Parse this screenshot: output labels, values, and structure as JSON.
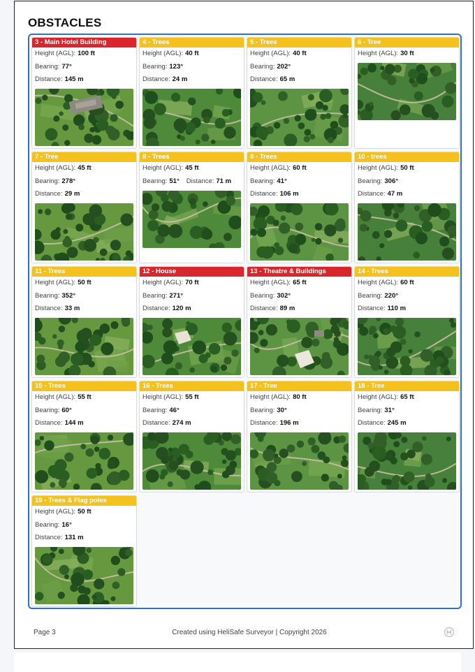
{
  "title": "OBSTACLES",
  "labels": {
    "height": "Height (AGL):",
    "bearing": "Bearing:",
    "distance": "Distance:"
  },
  "colors": {
    "caution": "#f5c11c",
    "hazard": "#d9262c",
    "panel_border": "#2e72c8"
  },
  "obstacles": [
    {
      "header": "3 - Main Hotel Building",
      "level": "red",
      "height": "100 ft",
      "bearing": "77°",
      "distance": "145 m",
      "image": "aerial-photo-hotel"
    },
    {
      "header": "4 - Trees",
      "level": "yellow",
      "height": "40 ft",
      "bearing": "123°",
      "distance": "24 m",
      "image": "aerial-photo-trees"
    },
    {
      "header": "5 - Trees",
      "level": "yellow",
      "height": "40 ft",
      "bearing": "202°",
      "distance": "65 m",
      "image": "aerial-photo-trees"
    },
    {
      "header": "6 - Tree",
      "level": "yellow",
      "height": "30 ft",
      "bearing": "",
      "distance": "",
      "image": "aerial-photo-tree"
    },
    {
      "header": "7 - Tree",
      "level": "yellow",
      "height": "45 ft",
      "bearing": "278°",
      "distance": "29 m",
      "image": "aerial-photo-tree"
    },
    {
      "header": "8 - Trees",
      "level": "yellow",
      "height": "45 ft",
      "bearing": "51°",
      "distance": "71 m",
      "inline": true,
      "image": "aerial-photo-trees"
    },
    {
      "header": "9 - Trees",
      "level": "yellow",
      "height": "60 ft",
      "bearing": "41°",
      "distance": "106 m",
      "image": "aerial-photo-trees"
    },
    {
      "header": "10 - trees",
      "level": "yellow",
      "height": "50 ft",
      "bearing": "306°",
      "distance": "47 m",
      "image": "aerial-photo-trees"
    },
    {
      "header": "11 - Trees",
      "level": "yellow",
      "height": "50 ft",
      "bearing": "352°",
      "distance": "33 m",
      "image": "aerial-photo-trees"
    },
    {
      "header": "12 - House",
      "level": "red",
      "height": "70 ft",
      "bearing": "271°",
      "distance": "120 m",
      "image": "aerial-photo-house"
    },
    {
      "header": "13 - Theatre & Buildings",
      "level": "red",
      "height": "65 ft",
      "bearing": "302°",
      "distance": "89 m",
      "image": "aerial-photo-theatre"
    },
    {
      "header": "14 - Trees",
      "level": "yellow",
      "height": "60 ft",
      "bearing": "220°",
      "distance": "110 m",
      "image": "aerial-photo-trees"
    },
    {
      "header": "15 - Trees",
      "level": "yellow",
      "height": "55 ft",
      "bearing": "60°",
      "distance": "144 m",
      "image": "aerial-photo-trees"
    },
    {
      "header": "16 - Trees",
      "level": "yellow",
      "height": "55 ft",
      "bearing": "46°",
      "distance": "274 m",
      "image": "aerial-photo-trees"
    },
    {
      "header": "17 - Tree",
      "level": "yellow",
      "height": "80 ft",
      "bearing": "30°",
      "distance": "196 m",
      "image": "aerial-photo-tree"
    },
    {
      "header": "18 - Tree",
      "level": "yellow",
      "height": "65 ft",
      "bearing": "31°",
      "distance": "245 m",
      "image": "aerial-photo-tree"
    },
    {
      "header": "19 - Trees & Flag poles",
      "level": "yellow",
      "height": "50 ft",
      "bearing": "16°",
      "distance": "131 m",
      "image": "aerial-photo-trees-flagpoles"
    }
  ],
  "footer": {
    "page": "Page 3",
    "credit": "Created using HeliSafe Surveyor | Copyright 2026",
    "logo_icon": "helisafe-logo-icon"
  }
}
